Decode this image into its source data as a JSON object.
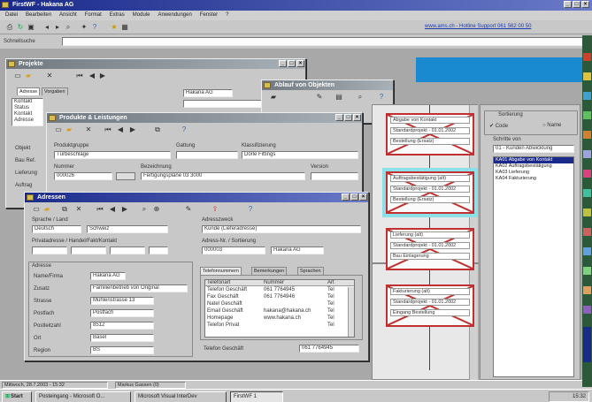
{
  "app": {
    "title": "FirstWF - Hakana AG"
  },
  "menu": [
    "Datei",
    "Bearbeiten",
    "Ansicht",
    "Format",
    "Extras",
    "Module",
    "Anwendungen",
    "Fenster",
    "?"
  ],
  "address": {
    "link": "www.ams.ch - Hotline Support 061 562 00 50",
    "label": "Schnellsuche"
  },
  "projekte": {
    "title": "Projekte",
    "tabs": [
      "Adresse",
      "Vorgaben"
    ],
    "field1": "Hakana AG",
    "labels_left": [
      "Kontakt",
      "Status Kontakt",
      "Adresse"
    ],
    "labels_mid": [
      "Objekt",
      "Bau Ref.",
      "Lieferung",
      "Auftrag"
    ]
  },
  "ablauf": {
    "title": "Ablauf von Objekten"
  },
  "produkte": {
    "title": "Produkte & Leistungen",
    "labels": [
      "Produktgruppe",
      "Gattung",
      "Klassifizierung",
      "Nummer",
      "Bezeichnung",
      "Version"
    ],
    "values": [
      "Türbeschläge",
      "",
      "Dörle Fittings",
      "000026",
      "Fertigungspläne 03 3000",
      ""
    ]
  },
  "adressen": {
    "title": "Adressen",
    "labels_top": [
      "Sprache / Land",
      "Adresszweck",
      "Privatadresse / Handel/Fakt/Kontakt",
      "Adress-Nr. / Sortierung"
    ],
    "values_top": [
      "Deutsch",
      "Schweiz",
      "Kunde (Lieferadresse)",
      "000003",
      "Hakana AG"
    ],
    "section": "Adresse",
    "fields": [
      {
        "label": "Name/Firma",
        "value": "Hakana AG"
      },
      {
        "label": "Zusatz",
        "value": "Familienbetrieb von Original"
      },
      {
        "label": "Strasse",
        "value": "Mühlenstrasse 13"
      },
      {
        "label": "Postfach",
        "value": "Postfach"
      },
      {
        "label": "Postleitzahl",
        "value": "8512"
      },
      {
        "label": "Ort",
        "value": "Basel"
      },
      {
        "label": "Region",
        "value": "BS"
      }
    ],
    "tabs": [
      "Telefonnummern",
      "Bemerkungen",
      "Sprachen"
    ],
    "table_headers": [
      "Telefonart",
      "Nummer",
      "Art"
    ],
    "table_rows": [
      [
        "Telefon Geschäft",
        "061 7764945",
        "Tel"
      ],
      [
        "Fax Geschäft",
        "061 7764946",
        "Tel"
      ],
      [
        "Natel Geschäft",
        "",
        "Tel"
      ],
      [
        "Email Geschäft",
        "hakana@hakana.ch",
        "Tel"
      ],
      [
        "Homepage",
        "www.hakana.ch",
        "Tel"
      ],
      [
        "Telefon Privat",
        "",
        "Tel"
      ]
    ],
    "footer_label": "Telefon Geschäft",
    "footer_value": "061 7764945"
  },
  "flow": {
    "boxes": [
      {
        "title": "Abgabe von Kontakt",
        "status": "Standardprojekt - 01.01.2002",
        "sub": "Bestellung (Ersatz)"
      },
      {
        "title": "Auftragsbestätigung (alt)",
        "status": "Standardprojekt - 01.01.2002",
        "sub": "Bestellung (Ersatz)"
      },
      {
        "title": "Lieferung (alt)",
        "status": "Standardprojekt - 01.01.2002",
        "sub": "Bau Einlagerung"
      },
      {
        "title": "Fakturierung (alt)",
        "status": "Standardprojekt - 01.01.2002",
        "sub": "Eingang Bestellung"
      }
    ]
  },
  "side": {
    "label1": "Sortierung",
    "radio1": "Code",
    "radio2": "Name",
    "label2": "Schritte von",
    "select": "01 - Kunden Abwicklung",
    "items": [
      [
        "KA01",
        "Abgabe von Kontakt"
      ],
      [
        "KA02",
        "Auftragsbestätigung"
      ],
      [
        "KA03",
        "Lieferung"
      ],
      [
        "KA04",
        "Fakturierung"
      ]
    ]
  },
  "status": {
    "left": "Mittwoch, 28.7.2003 - 15:32",
    "right": "Markus Gassen (0)"
  },
  "taskbar": {
    "start": "Start",
    "tasks": [
      "Posteingang - Microsoft O...",
      "Microsoft Visual InterDev",
      "FirstWF 1"
    ],
    "time": "15:32"
  },
  "colors": {
    "title_active": "#1a2a8a",
    "flow_red": "#c03030",
    "highlight": "#8ce0e8",
    "desktop": "#1a8ad0"
  }
}
